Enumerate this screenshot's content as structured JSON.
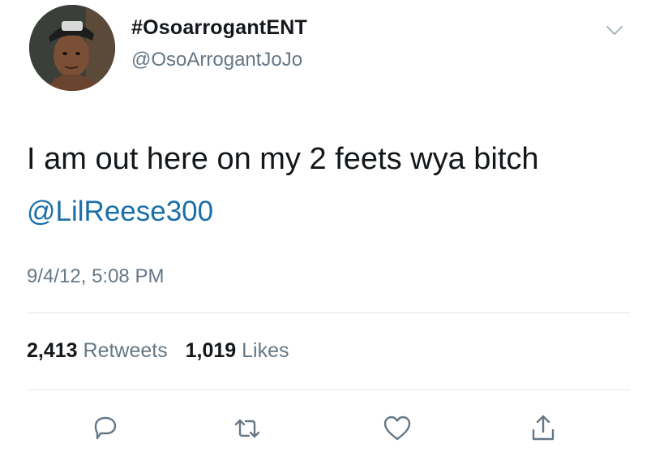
{
  "user": {
    "display_name": "#OsoarrogantENT",
    "handle": "@OsoArrogantJoJo"
  },
  "tweet": {
    "text": "I am out here on my 2 feets wya bitch",
    "mention": "@LilReese300",
    "timestamp": "9/4/12, 5:08 PM"
  },
  "stats": {
    "retweets_count": "2,413",
    "retweets_label": "Retweets",
    "likes_count": "1,019",
    "likes_label": "Likes"
  },
  "actions": {
    "reply_icon": "reply-icon",
    "retweet_icon": "retweet-icon",
    "like_icon": "heart-icon",
    "share_icon": "share-icon"
  },
  "colors": {
    "text": "#14171a",
    "secondary": "#657786",
    "link": "#1b6fa8",
    "divider": "#e1e8ed"
  }
}
